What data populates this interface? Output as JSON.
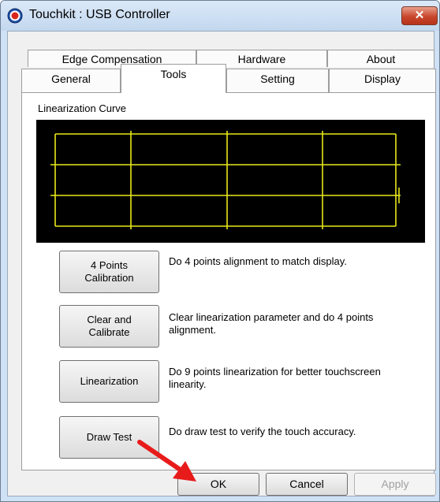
{
  "window": {
    "title": "Touchkit : USB Controller",
    "close_glyph": "✕"
  },
  "tabs_back": [
    "Edge Compensation",
    "Hardware",
    "About"
  ],
  "tabs_front": [
    "General",
    "Tools",
    "Setting",
    "Display"
  ],
  "active_tab": "Tools",
  "panel": {
    "title": "Linearization Curve"
  },
  "actions": [
    {
      "label": "4 Points\nCalibration",
      "description": "Do 4 points alignment to match display."
    },
    {
      "label": "Clear and\nCalibrate",
      "description": "Clear linearization parameter and do 4 points alignment."
    },
    {
      "label": "Linearization",
      "description": "Do 9 points linearization for better touchscreen linearity."
    },
    {
      "label": "Draw Test",
      "description": "Do draw test to verify the touch accuracy."
    }
  ],
  "dialog_buttons": {
    "ok": "OK",
    "cancel": "Cancel",
    "apply": "Apply"
  },
  "colors": {
    "curve_bg": "#000000",
    "curve_line": "#e8e81a",
    "arrow": "#e81b1b"
  },
  "icons": {
    "app": "touchkit-app-icon",
    "close": "close-icon",
    "annotation": "red-arrow-icon"
  }
}
